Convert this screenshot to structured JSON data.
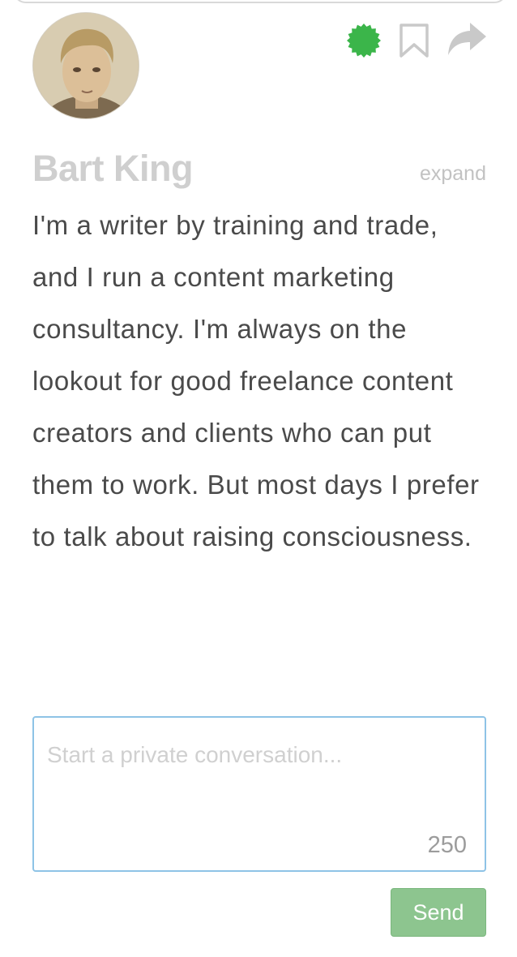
{
  "profile": {
    "name": "Bart King",
    "expand_label": "expand",
    "bio": "I'm a writer by training and trade, and I run a content marketing consultancy. I'm always on the lookout for good freelance content creators and clients who can put them to work. But most days I prefer to talk about raising consciousness."
  },
  "actions": {
    "icons": [
      "verified-badge-icon",
      "bookmark-icon",
      "share-arrow-icon"
    ],
    "badge_color": "#3bb54a",
    "icon_color": "#c9c9c9"
  },
  "message": {
    "placeholder": "Start a private conversation...",
    "value": "",
    "char_count": "250"
  },
  "send": {
    "label": "Send",
    "color": "#8dc58f"
  }
}
